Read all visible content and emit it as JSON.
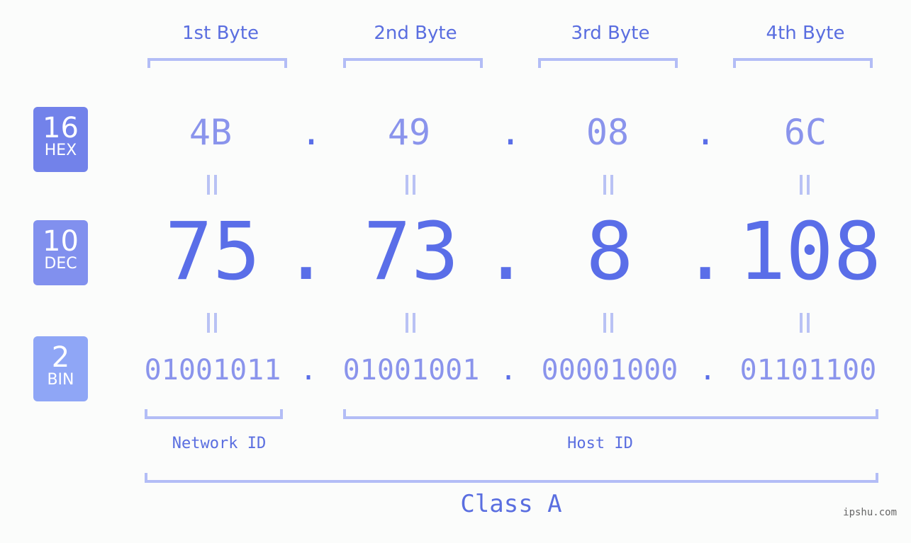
{
  "badges": {
    "hex": {
      "num": "16",
      "label": "HEX",
      "color": "#7282ea"
    },
    "dec": {
      "num": "10",
      "label": "DEC",
      "color": "#8190ee"
    },
    "bin": {
      "num": "2",
      "label": "BIN",
      "color": "#8fa6f6"
    }
  },
  "bytes": [
    {
      "header": "1st Byte",
      "hex": "4B",
      "dec": "75",
      "bin": "01001011"
    },
    {
      "header": "2nd Byte",
      "hex": "49",
      "dec": "73",
      "bin": "01001001"
    },
    {
      "header": "3rd Byte",
      "hex": "08",
      "dec": "8",
      "bin": "00001000"
    },
    {
      "header": "4th Byte",
      "hex": "6C",
      "dec": "108",
      "bin": "01101100"
    }
  ],
  "separator": ".",
  "labels": {
    "network_id": "Network ID",
    "host_id": "Host ID",
    "class": "Class A"
  },
  "watermark": "ipshu.com"
}
